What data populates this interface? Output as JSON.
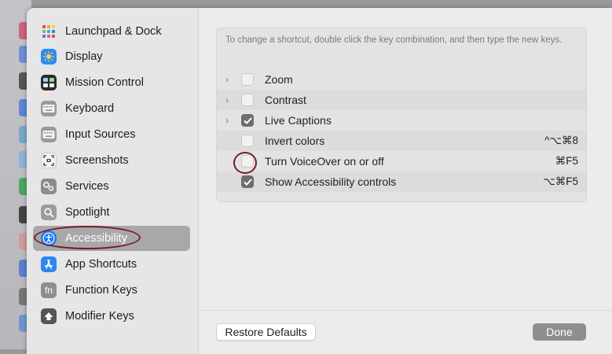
{
  "sidebar": {
    "items": [
      {
        "label": "Launchpad & Dock",
        "icon": "launchpad-icon"
      },
      {
        "label": "Display",
        "icon": "display-icon"
      },
      {
        "label": "Mission Control",
        "icon": "mission-control-icon"
      },
      {
        "label": "Keyboard",
        "icon": "keyboard-icon"
      },
      {
        "label": "Input Sources",
        "icon": "input-sources-icon"
      },
      {
        "label": "Screenshots",
        "icon": "screenshots-icon"
      },
      {
        "label": "Services",
        "icon": "services-icon"
      },
      {
        "label": "Spotlight",
        "icon": "spotlight-icon"
      },
      {
        "label": "Accessibility",
        "icon": "accessibility-icon",
        "selected": true
      },
      {
        "label": "App Shortcuts",
        "icon": "app-shortcuts-icon"
      },
      {
        "label": "Function Keys",
        "icon": "function-keys-icon",
        "icon_text": "fn"
      },
      {
        "label": "Modifier Keys",
        "icon": "modifier-keys-icon"
      }
    ]
  },
  "main": {
    "instructions": "To change a shortcut, double click the key combination, and then type the new keys.",
    "shortcuts": [
      {
        "label": "Zoom",
        "expandable": true,
        "checked": false,
        "shortcut": ""
      },
      {
        "label": "Contrast",
        "expandable": true,
        "checked": false,
        "shortcut": ""
      },
      {
        "label": "Live Captions",
        "expandable": true,
        "checked": true,
        "shortcut": ""
      },
      {
        "label": "Invert colors",
        "expandable": false,
        "checked": false,
        "shortcut": "^⌥⌘8"
      },
      {
        "label": "Turn VoiceOver on or off",
        "expandable": false,
        "checked": false,
        "shortcut": "⌘F5"
      },
      {
        "label": "Show Accessibility controls",
        "expandable": false,
        "checked": true,
        "shortcut": "⌥⌘F5"
      }
    ],
    "restore_label": "Restore Defaults",
    "done_label": "Done"
  },
  "colors": {
    "annotation": "#7a1a25",
    "selected_bg": "#a8a8a8",
    "accessibility_blue": "#1a7cf0"
  }
}
